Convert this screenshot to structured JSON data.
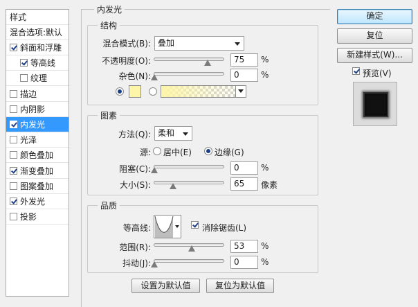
{
  "style_list": {
    "header": "样式",
    "blend_options": "混合选项:默认",
    "items": [
      {
        "label": "斜面和浮雕",
        "checked": true,
        "sub": false,
        "selected": false
      },
      {
        "label": "等高线",
        "checked": true,
        "sub": true,
        "selected": false
      },
      {
        "label": "纹理",
        "checked": false,
        "sub": true,
        "selected": false
      },
      {
        "label": "描边",
        "checked": false,
        "sub": false,
        "selected": false
      },
      {
        "label": "内阴影",
        "checked": false,
        "sub": false,
        "selected": false
      },
      {
        "label": "内发光",
        "checked": true,
        "sub": false,
        "selected": true
      },
      {
        "label": "光泽",
        "checked": false,
        "sub": false,
        "selected": false
      },
      {
        "label": "颜色叠加",
        "checked": false,
        "sub": false,
        "selected": false
      },
      {
        "label": "渐变叠加",
        "checked": true,
        "sub": false,
        "selected": false
      },
      {
        "label": "图案叠加",
        "checked": false,
        "sub": false,
        "selected": false
      },
      {
        "label": "外发光",
        "checked": true,
        "sub": false,
        "selected": false
      },
      {
        "label": "投影",
        "checked": false,
        "sub": false,
        "selected": false
      }
    ]
  },
  "panel": {
    "title": "内发光",
    "structure": {
      "legend": "结构",
      "blend_mode_label": "混合模式(B):",
      "blend_mode_value": "叠加",
      "opacity_label": "不透明度(O):",
      "opacity_value": "75",
      "opacity_fraction": 0.75,
      "noise_label": "杂色(N):",
      "noise_value": "0",
      "noise_fraction": 0,
      "percent": "%",
      "color_swatch": "#fdf5a8"
    },
    "elements": {
      "legend": "图素",
      "method_label": "方法(Q):",
      "method_value": "柔和",
      "source_label": "源:",
      "center_label": "居中(E)",
      "edge_label": "边缘(G)",
      "choke_label": "阻塞(C):",
      "choke_value": "0",
      "choke_fraction": 0,
      "size_label": "大小(S):",
      "size_value": "65",
      "size_fraction": 0.26,
      "size_unit": "像素",
      "percent": "%"
    },
    "quality": {
      "legend": "品质",
      "contour_label": "等高线:",
      "anti_alias_label": "消除锯齿(L)",
      "range_label": "范围(R):",
      "range_value": "53",
      "range_fraction": 0.53,
      "jitter_label": "抖动(J):",
      "jitter_value": "0",
      "jitter_fraction": 0,
      "percent": "%"
    },
    "set_default_label": "设置为默认值",
    "reset_default_label": "复位为默认值"
  },
  "right": {
    "ok_label": "确定",
    "reset_label": "复位",
    "new_style_label": "新建样式(W)...",
    "preview_label": "预览(V)"
  }
}
